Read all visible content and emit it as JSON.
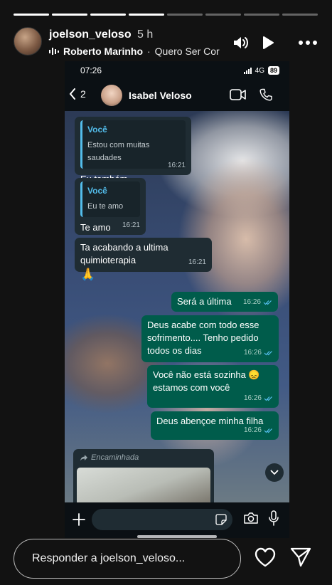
{
  "story": {
    "progress_segments": 8,
    "progress_done": 4,
    "username": "joelson_veloso",
    "time": "5 h",
    "music_artist": "Roberto Marinho",
    "music_separator": "·",
    "music_title": "Quero Ser Cor"
  },
  "phone": {
    "status_time": "07:26",
    "network": "4G",
    "battery": "89"
  },
  "chat": {
    "back_count": "2",
    "contact_name": "Isabel Veloso",
    "messages": [
      {
        "dir": "in",
        "quote_author": "Você",
        "quote_text": "Estou com muitas saudades",
        "text": "Eu também",
        "time": "16:21"
      },
      {
        "dir": "in",
        "quote_author": "Você",
        "quote_text": "Eu te amo",
        "text": "Te amo",
        "time": "16:21"
      },
      {
        "dir": "in",
        "text": "Ta acabando a ultima quimioterapia",
        "time": "16:21"
      },
      {
        "dir": "in",
        "text": "🙏"
      },
      {
        "dir": "out",
        "text": "Será a última",
        "time": "16:26"
      },
      {
        "dir": "out",
        "text": "Deus acabe com todo esse sofrimento.... Tenho pedido todos os dias",
        "time": "16:26"
      },
      {
        "dir": "out",
        "text": "Você não está sozinha 😞 estamos com você",
        "time": "16:26"
      },
      {
        "dir": "out",
        "text": "Deus abençoe minha filha",
        "time": "16:26"
      }
    ],
    "forwarded_label": "Encaminhada"
  },
  "reply": {
    "placeholder": "Responder a joelson_veloso..."
  },
  "colors": {
    "incoming_bubble": "#1f2c33",
    "outgoing_bubble": "#005c4b",
    "quote_accent": "#53bdeb",
    "read_ticks": "#53bdeb"
  },
  "icons": [
    "volume-icon",
    "play-icon",
    "more-icon",
    "music-icon",
    "back-chevron-icon",
    "video-call-icon",
    "phone-call-icon",
    "scroll-down-icon",
    "forward-icon",
    "plus-icon",
    "sticker-icon",
    "camera-icon",
    "microphone-icon",
    "heart-icon",
    "send-icon"
  ]
}
